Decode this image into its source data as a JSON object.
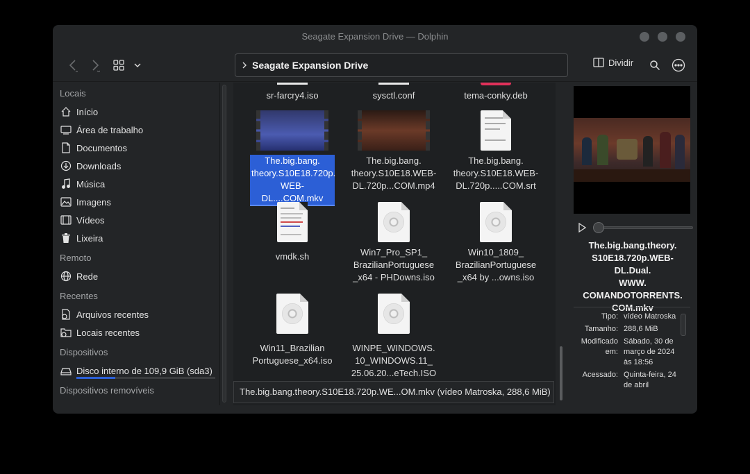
{
  "window": {
    "title": "Seagate Expansion Drive — Dolphin"
  },
  "toolbar": {
    "location": "Seagate Expansion Drive",
    "split_label": "Dividir"
  },
  "sidebar": {
    "sections": [
      {
        "title": "Locais",
        "items": [
          {
            "label": "Início",
            "icon": "home-icon"
          },
          {
            "label": "Área de trabalho",
            "icon": "desktop-icon"
          },
          {
            "label": "Documentos",
            "icon": "documents-icon"
          },
          {
            "label": "Downloads",
            "icon": "downloads-icon"
          },
          {
            "label": "Música",
            "icon": "music-icon"
          },
          {
            "label": "Imagens",
            "icon": "images-icon"
          },
          {
            "label": "Vídeos",
            "icon": "videos-icon"
          },
          {
            "label": "Lixeira",
            "icon": "trash-icon"
          }
        ]
      },
      {
        "title": "Remoto",
        "items": [
          {
            "label": "Rede",
            "icon": "network-icon"
          }
        ]
      },
      {
        "title": "Recentes",
        "items": [
          {
            "label": "Arquivos recentes",
            "icon": "recent-files-icon"
          },
          {
            "label": "Locais recentes",
            "icon": "recent-places-icon"
          }
        ]
      },
      {
        "title": "Dispositivos",
        "items": [
          {
            "label": "Disco interno de 109,9 GiB (sda3)",
            "icon": "drive-icon",
            "usage": 0.28
          }
        ]
      },
      {
        "title": "Dispositivos removíveis",
        "items": []
      }
    ]
  },
  "files": [
    {
      "name": "sr-farcry4.iso",
      "type": "partial"
    },
    {
      "name": "sysctl.conf",
      "type": "partial"
    },
    {
      "name": "tema-conky.deb",
      "type": "partial"
    },
    {
      "name": "The.big.bang.\ntheory.S10E18.720p.\nWEB-DL....COM.mkv",
      "type": "video",
      "selected": true
    },
    {
      "name": "The.big.bang.\ntheory.S10E18.WEB-\nDL.720p...COM.mp4",
      "type": "video"
    },
    {
      "name": "The.big.bang.\ntheory.S10E18.WEB-\nDL.720p.....COM.srt",
      "type": "text"
    },
    {
      "name": "vmdk.sh",
      "type": "text"
    },
    {
      "name": "Win7_Pro_SP1_\nBrazilianPortuguese\n_x64 - PHDowns.iso",
      "type": "iso"
    },
    {
      "name": "Win10_1809_\nBrazilianPortuguese\n_x64 by ...owns.iso",
      "type": "iso"
    },
    {
      "name": "Win11_Brazilian\nPortuguese_x64.iso",
      "type": "iso"
    },
    {
      "name": "WINPE_WINDOWS.\n10_WINDOWS.11_\n25.06.20...eTech.ISO",
      "type": "iso"
    }
  ],
  "status": {
    "text": "The.big.bang.theory.S10E18.720p.WE...OM.mkv (vídeo Matroska, 288,6 MiB)"
  },
  "info": {
    "title": "The.big.bang.theory.\nS10E18.720p.WEB-DL.Dual.\nWWW.\nCOMANDOTORRENTS.\nCOM.mkv",
    "meta": [
      {
        "k": "Tipo:",
        "v": "vídeo Matroska"
      },
      {
        "k": "Tamanho:",
        "v": "288,6 MiB"
      },
      {
        "k": "Modificado em:",
        "v": "Sábado, 30 de março de 2024 às 18:56"
      },
      {
        "k": "Acessado:",
        "v": "Quinta-feira, 24 de abril"
      }
    ]
  }
}
